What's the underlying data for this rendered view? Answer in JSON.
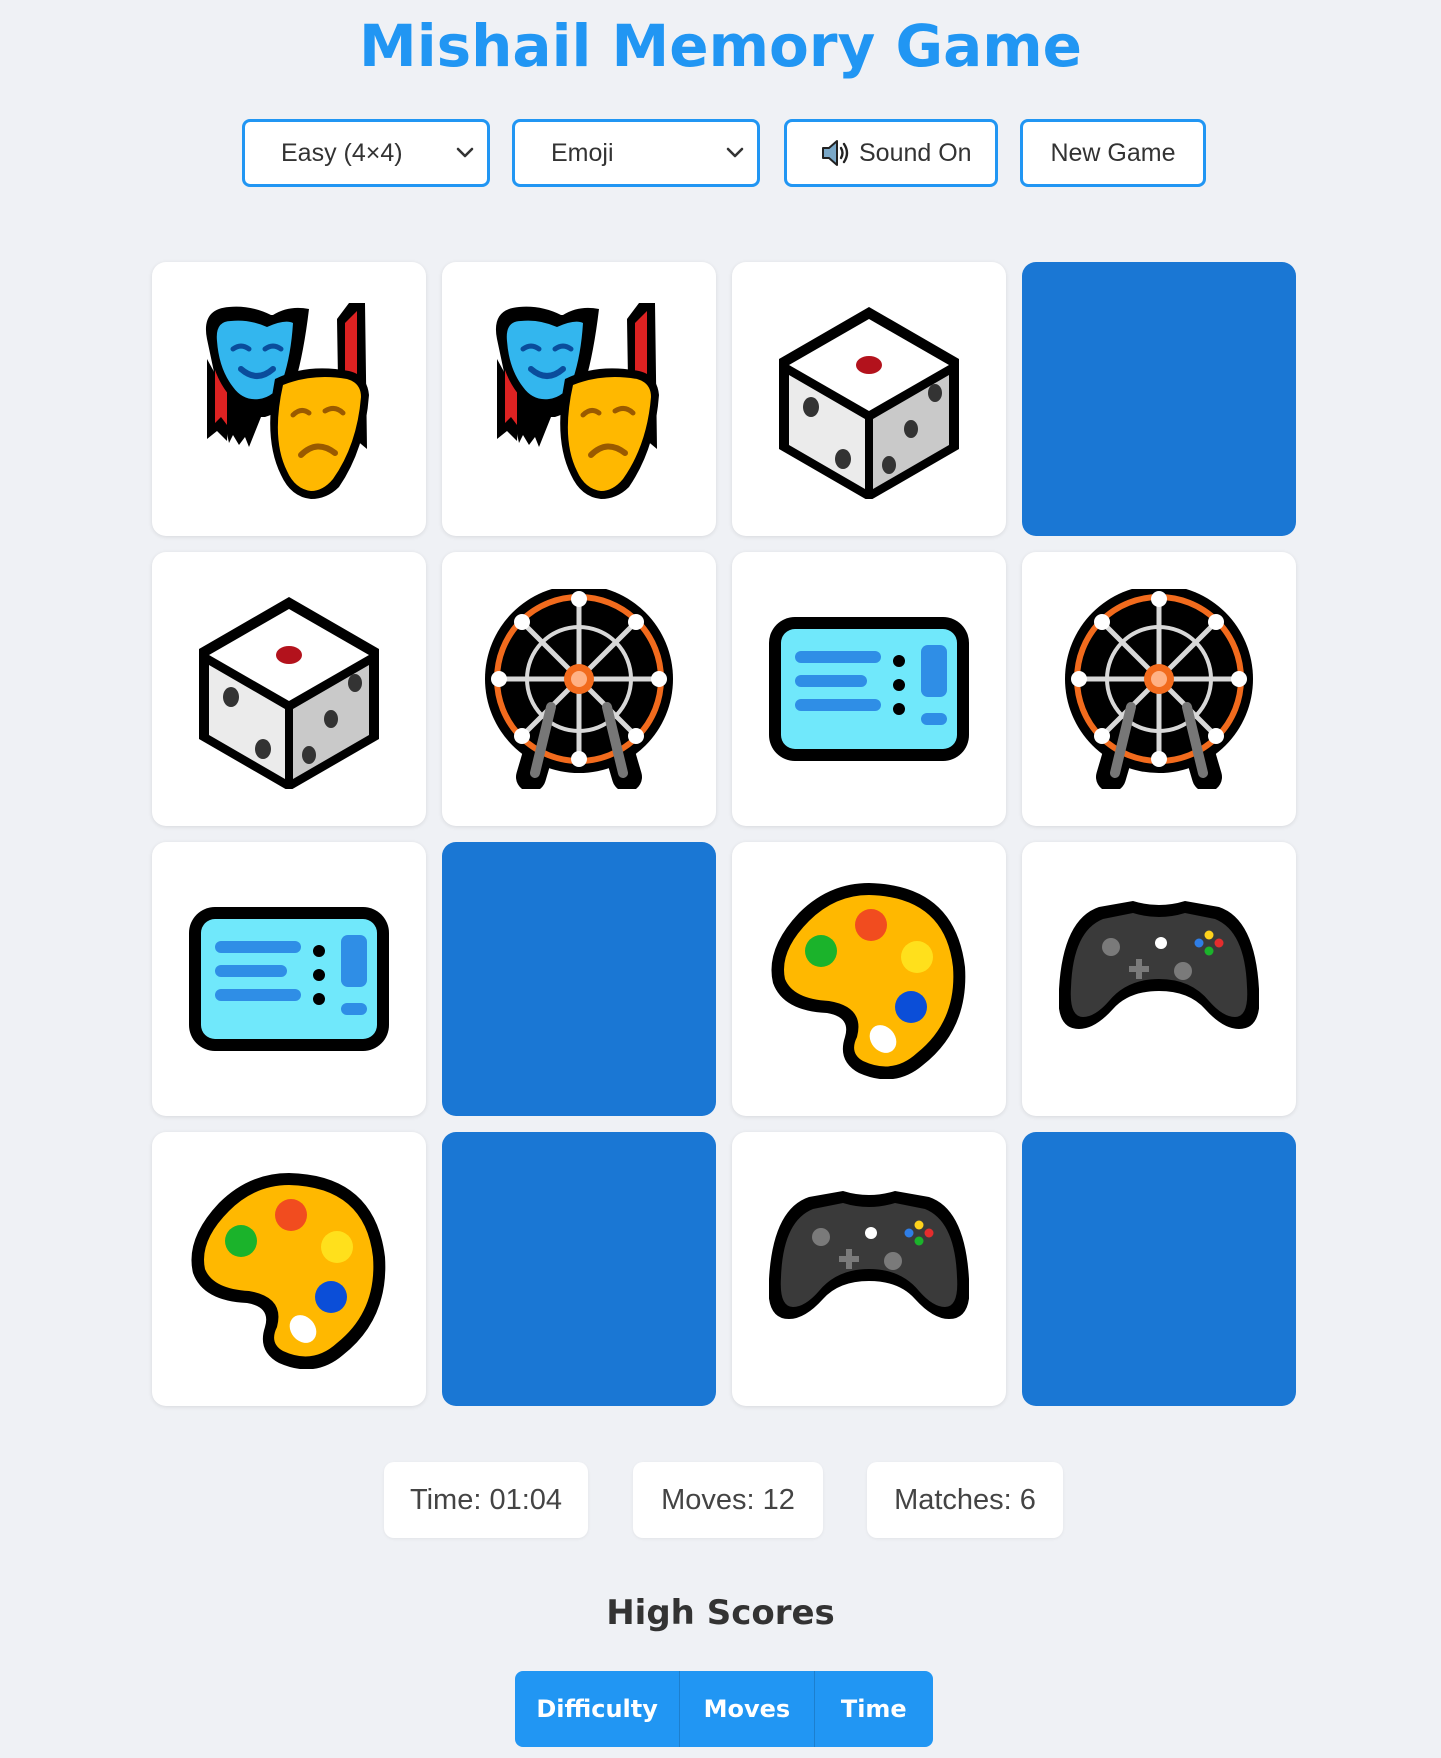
{
  "app": {
    "title": "Mishail Memory Game"
  },
  "controls": {
    "difficulty": {
      "selected": "Easy (4×4)",
      "icon": "chevron-down-icon"
    },
    "theme": {
      "selected": "Emoji",
      "icon": "chevron-down-icon"
    },
    "sound": {
      "label": "Sound On",
      "icon": "speaker-icon"
    },
    "new_game": {
      "label": "New Game"
    }
  },
  "board": {
    "rows": 4,
    "cols": 4,
    "face_down_color": "#1a77d4",
    "cards": [
      {
        "state": "up",
        "icon": "performing-arts"
      },
      {
        "state": "up",
        "icon": "performing-arts"
      },
      {
        "state": "up",
        "icon": "game-die"
      },
      {
        "state": "down",
        "icon": ""
      },
      {
        "state": "up",
        "icon": "game-die"
      },
      {
        "state": "up",
        "icon": "ferris-wheel"
      },
      {
        "state": "up",
        "icon": "ticket"
      },
      {
        "state": "up",
        "icon": "ferris-wheel"
      },
      {
        "state": "up",
        "icon": "ticket"
      },
      {
        "state": "down",
        "icon": ""
      },
      {
        "state": "up",
        "icon": "artist-palette"
      },
      {
        "state": "up",
        "icon": "video-game-controller"
      },
      {
        "state": "up",
        "icon": "artist-palette"
      },
      {
        "state": "down",
        "icon": ""
      },
      {
        "state": "up",
        "icon": "video-game-controller"
      },
      {
        "state": "down",
        "icon": ""
      }
    ]
  },
  "stats": {
    "time": "Time: 01:04",
    "moves": "Moves: 12",
    "matches": "Matches: 6"
  },
  "high_scores": {
    "title": "High Scores",
    "tabs": [
      "Difficulty",
      "Moves",
      "Time"
    ]
  },
  "colors": {
    "accent": "#2196f3",
    "background": "#eff1f5"
  }
}
